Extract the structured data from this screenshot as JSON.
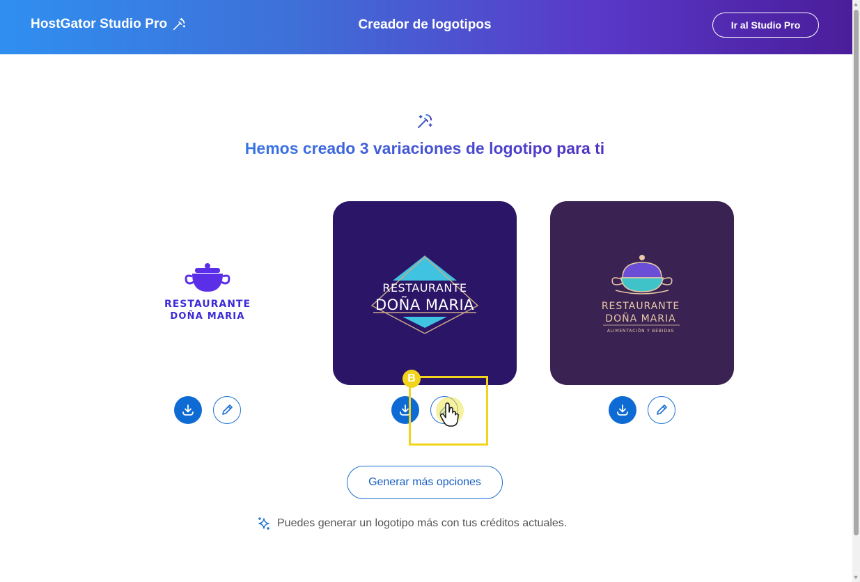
{
  "header": {
    "brand": "HostGator Studio Pro",
    "title": "Creador de logotipos",
    "studio_button": "Ir al Studio Pro"
  },
  "main": {
    "headline": "Hemos creado 3 variaciones de logotipo para ti",
    "logos": [
      {
        "line1": "RESTAURANTE",
        "line2": "DOÑA MARIA",
        "background": "#ffffff",
        "accent": "#5b2ee8"
      },
      {
        "line1": "RESTAURANTE",
        "line2": "DOÑA MARIA",
        "background": "#2b1566",
        "accent": "#3fc3e0"
      },
      {
        "line1": "RESTAURANTE",
        "line2": "DOÑA MARIA",
        "tagline": "ALIMENTACIÓN Y BEBIDAS",
        "background": "#3a2352",
        "accent": "#e9c9a7"
      }
    ],
    "actions": {
      "download_icon": "download-icon",
      "edit_icon": "pencil-icon"
    },
    "generate_button": "Generar más opciones",
    "credits_text": "Puedes generar un logotipo más con tus créditos actuales."
  },
  "overlay": {
    "badge": "B",
    "highlight_color": "#f2d41c"
  },
  "colors": {
    "primary": "#0f6bd4",
    "header_start": "#2f8ff0",
    "header_end": "#4a1d9a"
  }
}
